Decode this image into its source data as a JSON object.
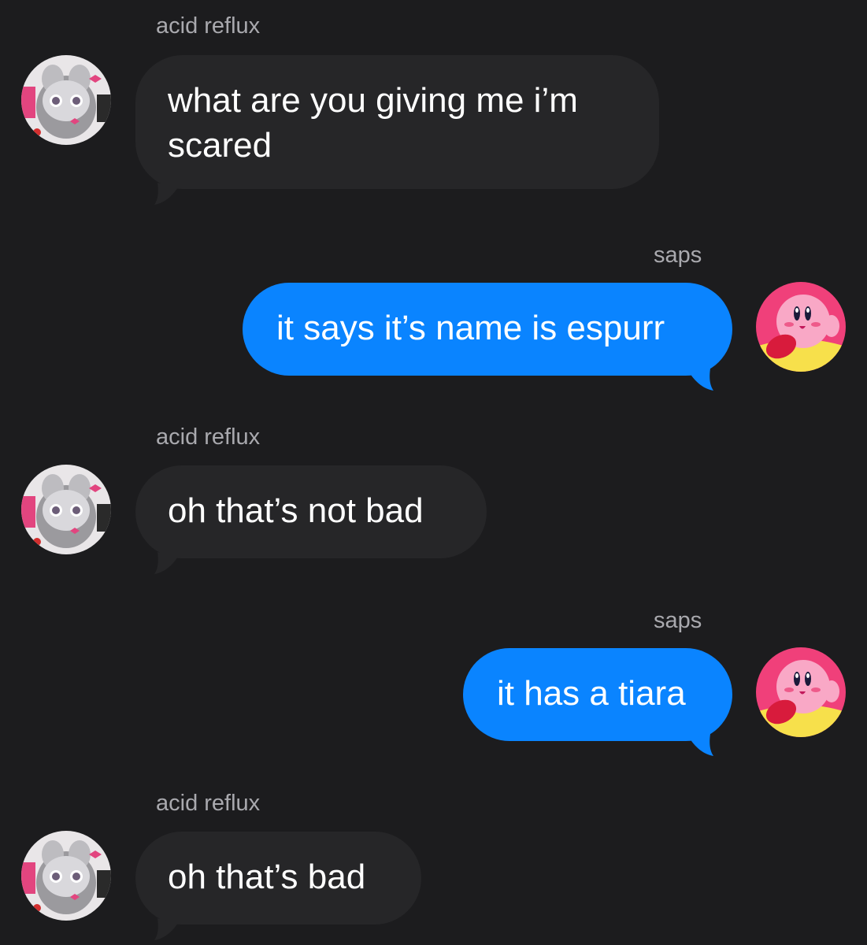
{
  "colors": {
    "background": "#1c1c1e",
    "received_bubble": "#262628",
    "sent_bubble": "#0a84ff",
    "sender_name": "#a9a9ae",
    "text": "#ffffff"
  },
  "messages": [
    {
      "sender": "acid reflux",
      "direction": "received",
      "text": "what are you giving me i’m\nscared",
      "avatar_icon": "espurr-avatar-icon"
    },
    {
      "sender": "saps",
      "direction": "sent",
      "text": "it says it’s name is espurr",
      "avatar_icon": "kirby-avatar-icon"
    },
    {
      "sender": "acid reflux",
      "direction": "received",
      "text": "oh that’s not bad",
      "avatar_icon": "espurr-avatar-icon"
    },
    {
      "sender": "saps",
      "direction": "sent",
      "text": "it has a tiara",
      "avatar_icon": "kirby-avatar-icon"
    },
    {
      "sender": "acid reflux",
      "direction": "received",
      "text": "oh that’s bad",
      "avatar_icon": "espurr-avatar-icon"
    }
  ]
}
